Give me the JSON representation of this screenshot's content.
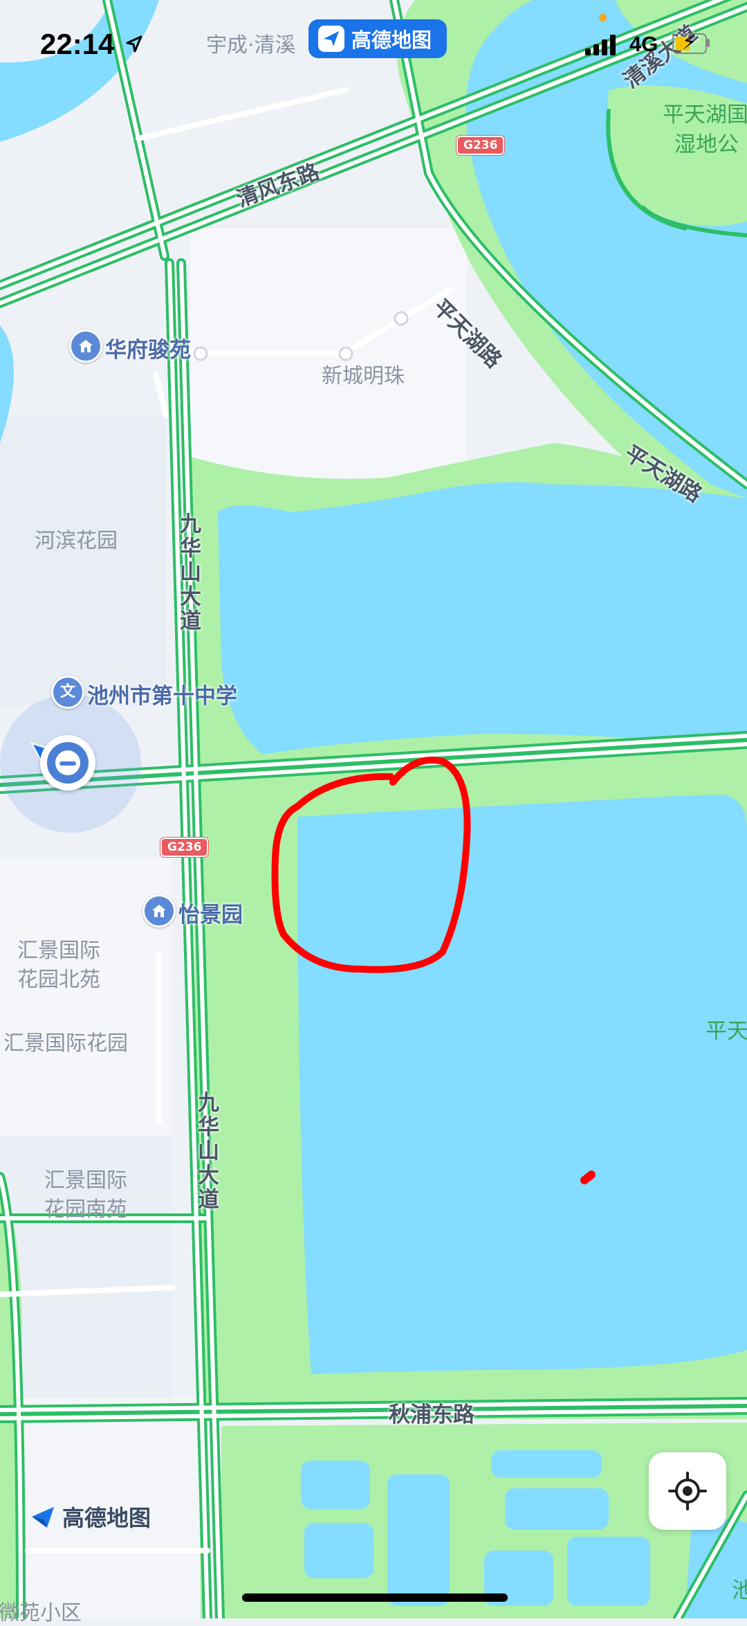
{
  "status_bar": {
    "time": "22:14",
    "app_return_label": "高德地图",
    "network": "4G"
  },
  "map": {
    "road_labels": {
      "qingfeng_east": "清风东路",
      "pingtianhu_1": "平天湖路",
      "pingtianhu_2": "平天湖路",
      "jiuhuashan_1": "九华山大道",
      "jiuhuashan_2": "九华山大道",
      "qiupu_east": "秋浦东路",
      "qingxi_avenue": "清溪大道",
      "highway_1": "G236",
      "highway_2": "G236"
    },
    "area_labels": {
      "yucheng": "宇成·清溪",
      "xincheng": "新城明珠",
      "hebin": "河滨花园",
      "huijing_north_1": "汇景国际",
      "huijing_north_2": "花园北苑",
      "huijing": "汇景国际花园",
      "huijing_south_1": "汇景国际",
      "huijing_south_2": "花园南苑",
      "cuiwei": "翠微苑小区",
      "right_edge_cut": "池"
    },
    "poi_labels": {
      "huafu": "华府骏苑",
      "school": "池州市第十中学",
      "yijing": "怡景园"
    },
    "poi_icons": {
      "school_glyph": "文"
    },
    "park_labels": {
      "wetland_1": "平天湖国",
      "wetland_2": "湿地公",
      "pingtian_cut": "平天"
    }
  },
  "brand_logo": "高德地图",
  "colors": {
    "water": "#84dcff",
    "park": "#aef0a8",
    "road": "#2dbe66",
    "annotation": "#ff0000",
    "app_pill": "#1a73e8",
    "highway_shield": "#ea5b5f"
  },
  "icons": [
    "location-arrow-icon",
    "signal-icon",
    "battery-charging-icon",
    "amap-logo-icon",
    "poi-house-icon",
    "poi-school-icon",
    "user-avatar-icon",
    "locate-me-icon"
  ]
}
